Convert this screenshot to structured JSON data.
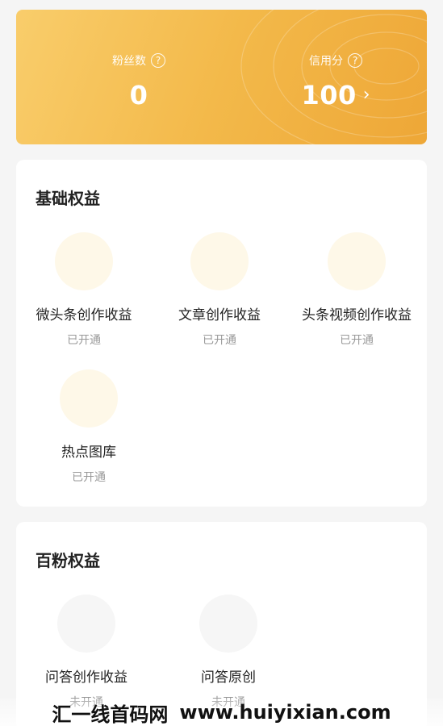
{
  "stats": {
    "fans": {
      "label": "粉丝数",
      "value": "0"
    },
    "credit": {
      "label": "信用分",
      "value": "100"
    },
    "help_icon": "question-circle-icon",
    "arrow_icon": "chevron-right-icon"
  },
  "basic": {
    "title": "基础权益",
    "items": [
      {
        "label": "微头条创作收益",
        "status": "已开通"
      },
      {
        "label": "文章创作收益",
        "status": "已开通"
      },
      {
        "label": "头条视频创作收益",
        "status": "已开通"
      },
      {
        "label": "热点图库",
        "status": "已开通"
      }
    ]
  },
  "hundred": {
    "title": "百粉权益",
    "items": [
      {
        "label": "问答创作收益",
        "status": "未开通"
      },
      {
        "label": "问答原创",
        "status": "未开通"
      }
    ]
  },
  "watermark": {
    "left": "汇一线首码网",
    "right": "www.huiyixian.com"
  },
  "colors": {
    "card_gradient_start": "#f9cd6b",
    "card_gradient_end": "#eea737",
    "enabled_icon_bg": "#fef8e8",
    "disabled_icon_bg": "#f6f6f6"
  }
}
